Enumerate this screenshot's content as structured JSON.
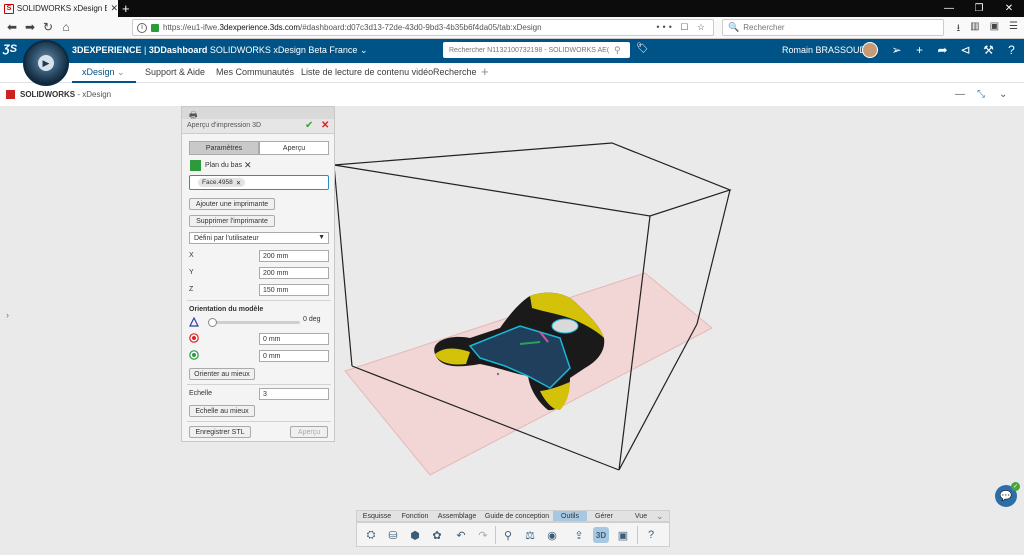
{
  "browser": {
    "tab_title": "SOLIDWORKS xDesign Beta Fra",
    "url_prefix": "https://eu1-ifwe.",
    "url_domain": "3dexperience.3ds.com",
    "url_suffix": "/#dashboard:d07c3d13-72de-43d0-9bd3-4b35b6f4da05/tab:xDesign",
    "url_actions": "••• ☐ ☆",
    "search_placeholder": "Rechercher",
    "window_controls": [
      "—",
      "❐",
      "✕"
    ]
  },
  "app": {
    "brand_bold": "3DEXPERIENCE",
    "brand_rest": " | ",
    "dashboard_bold": "3DDashboard",
    "dashboard_name": " SOLIDWORKS xDesign Beta France ⌄",
    "search_placeholder": "Rechercher N1132100732198 - SOLIDWORKS AE(",
    "user_name": "Romain BRASSOUD"
  },
  "tabs": [
    "xDesign",
    "Support & Aide",
    "Mes Communautés",
    "Liste de lecture de contenu vidéo",
    "Recherche"
  ],
  "widget": {
    "title_brand": "SOLIDWORKS",
    "title_app": " - xDesign"
  },
  "panel": {
    "title": "Aperçu d'impression 3D",
    "seg_params": "Paramètres",
    "seg_preview": "Aperçu",
    "plane_label": "Plan du bas",
    "face_chip": "Face.4958",
    "add_printer": "Ajouter une imprimante",
    "remove_printer": "Supprimer l'imprimante",
    "printer_select": "Défini par l'utilisateur",
    "x_label": "X",
    "x_value": "200 mm",
    "y_label": "Y",
    "y_value": "200 mm",
    "z_label": "Z",
    "z_value": "150 mm",
    "orientation_title": "Orientation du modèle",
    "rotation_value": "0 deg",
    "offset1": "0 mm",
    "offset2": "0 mm",
    "orient_best": "Orienter au mieux",
    "scale_label": "Echelle",
    "scale_value": "3",
    "scale_best": "Echelle au mieux",
    "save_stl": "Enregistrer STL",
    "preview_btn": "Aperçu"
  },
  "actionbar": {
    "tabs": [
      "Esquisse",
      "Fonction",
      "Assemblage",
      "Guide de conception",
      "Outils",
      "Gérer",
      "Vue"
    ],
    "active": "Outils"
  },
  "colors": {
    "header_blue": "#005386",
    "part_yellow": "#d4c20a",
    "build_plate": "#f2d6d6",
    "highlight_cyan": "#19b7d8"
  }
}
